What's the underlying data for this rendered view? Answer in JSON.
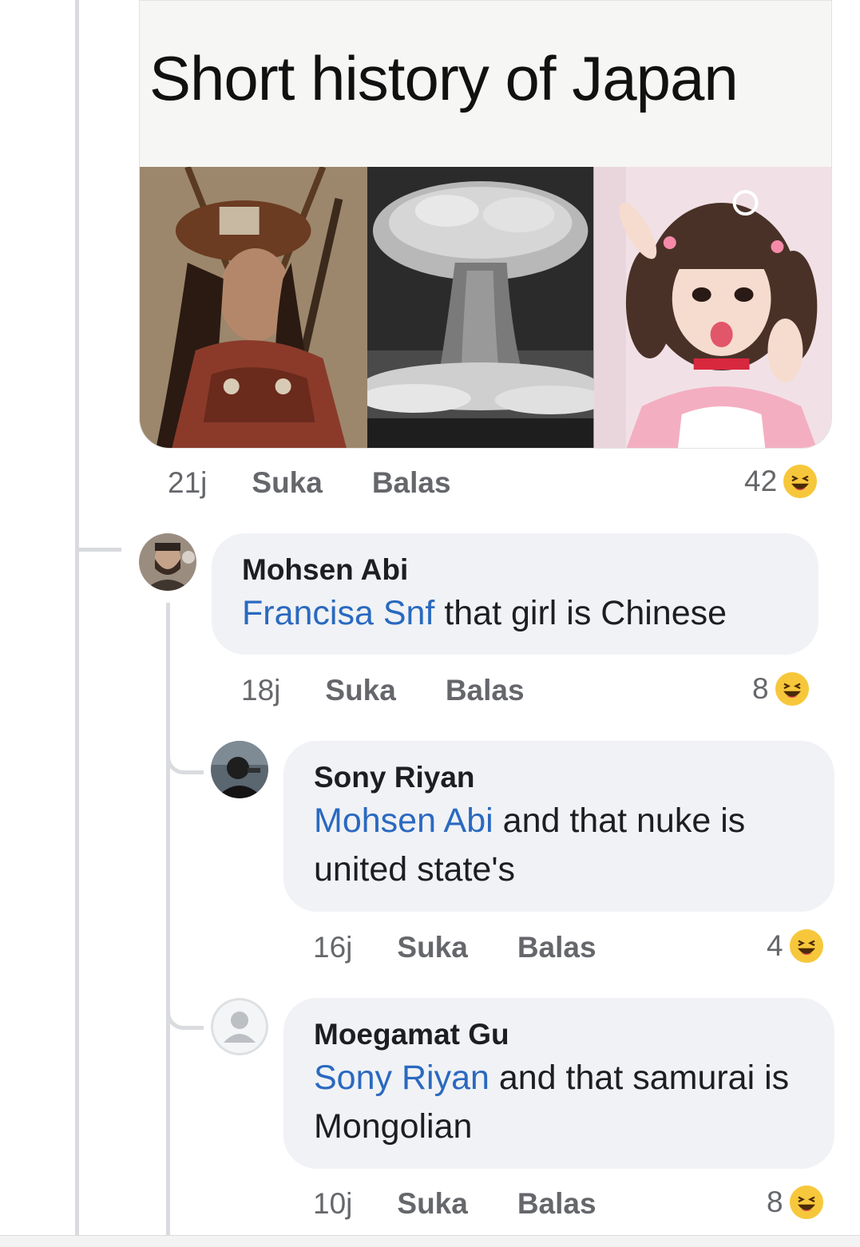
{
  "colors": {
    "mention": "#2a69c0",
    "bubble_bg": "#f0f2f5",
    "meta_text": "#65676b",
    "haha_yellow": "#f7c73b"
  },
  "post": {
    "meme_caption": "Short history of Japan",
    "panels": [
      "samurai-illustration",
      "mushroom-cloud-photo",
      "cosplay-girl-photo"
    ],
    "time": "21j",
    "like_label": "Suka",
    "reply_label": "Balas",
    "reaction_count": "42",
    "reaction_icon": "haha-emoji-icon"
  },
  "comments": [
    {
      "author": "Mohsen Abi",
      "mention": "Francisa Snf",
      "text": " that girl is Chinese",
      "time": "18j",
      "like_label": "Suka",
      "reply_label": "Balas",
      "reaction_count": "8"
    },
    {
      "author": "Sony Riyan",
      "mention": "Mohsen Abi",
      "text": " and that nuke is united state's",
      "time": "16j",
      "like_label": "Suka",
      "reply_label": "Balas",
      "reaction_count": "4"
    },
    {
      "author": "Moegamat Gu",
      "mention": "Sony Riyan",
      "text": " and that samurai is Mongolian",
      "time": "10j",
      "like_label": "Suka",
      "reply_label": "Balas",
      "reaction_count": "8"
    }
  ]
}
